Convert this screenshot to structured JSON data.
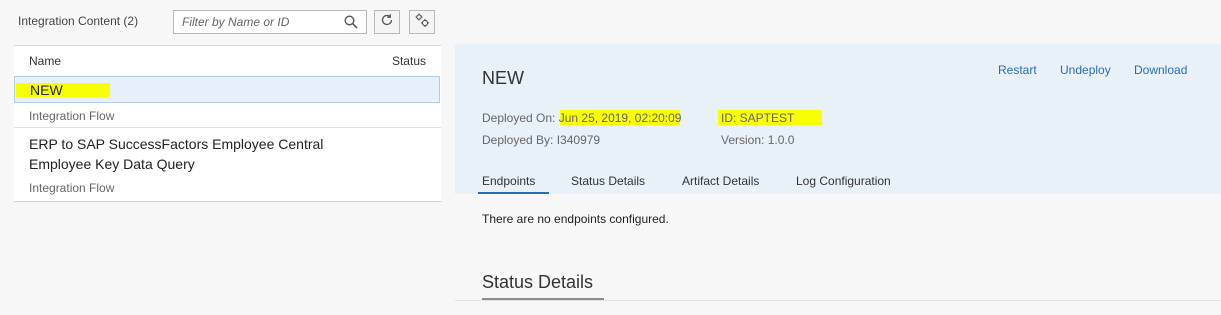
{
  "left": {
    "content_count": "Integration Content (2)",
    "filter_placeholder": "Filter by Name or ID",
    "columns": {
      "name": "Name",
      "status": "Status"
    },
    "items": [
      {
        "title": "NEW",
        "type": "Integration Flow"
      },
      {
        "title": "ERP to SAP SuccessFactors Employee Central Employee Key Data Query",
        "type": "Integration Flow"
      }
    ]
  },
  "detail": {
    "title": "NEW",
    "actions": {
      "restart": "Restart",
      "undeploy": "Undeploy",
      "download": "Download"
    },
    "deployed_on": "Deployed On: Jun 25, 2019, 02:20:09",
    "deployed_by": "Deployed By: I340979",
    "artifact_id": "ID: SAPTEST",
    "version": "Version: 1.0.0",
    "tabs": [
      "Endpoints",
      "Status Details",
      "Artifact Details",
      "Log Configuration"
    ],
    "endpoints_message": "There are no endpoints configured.",
    "status_heading": "Status Details"
  },
  "colors": {
    "accent": "#2a6cb0",
    "highlight": "#f7ff00",
    "selected_row": "#e5f0fa"
  },
  "icons": [
    "search-icon",
    "refresh-icon",
    "settings-icon"
  ]
}
